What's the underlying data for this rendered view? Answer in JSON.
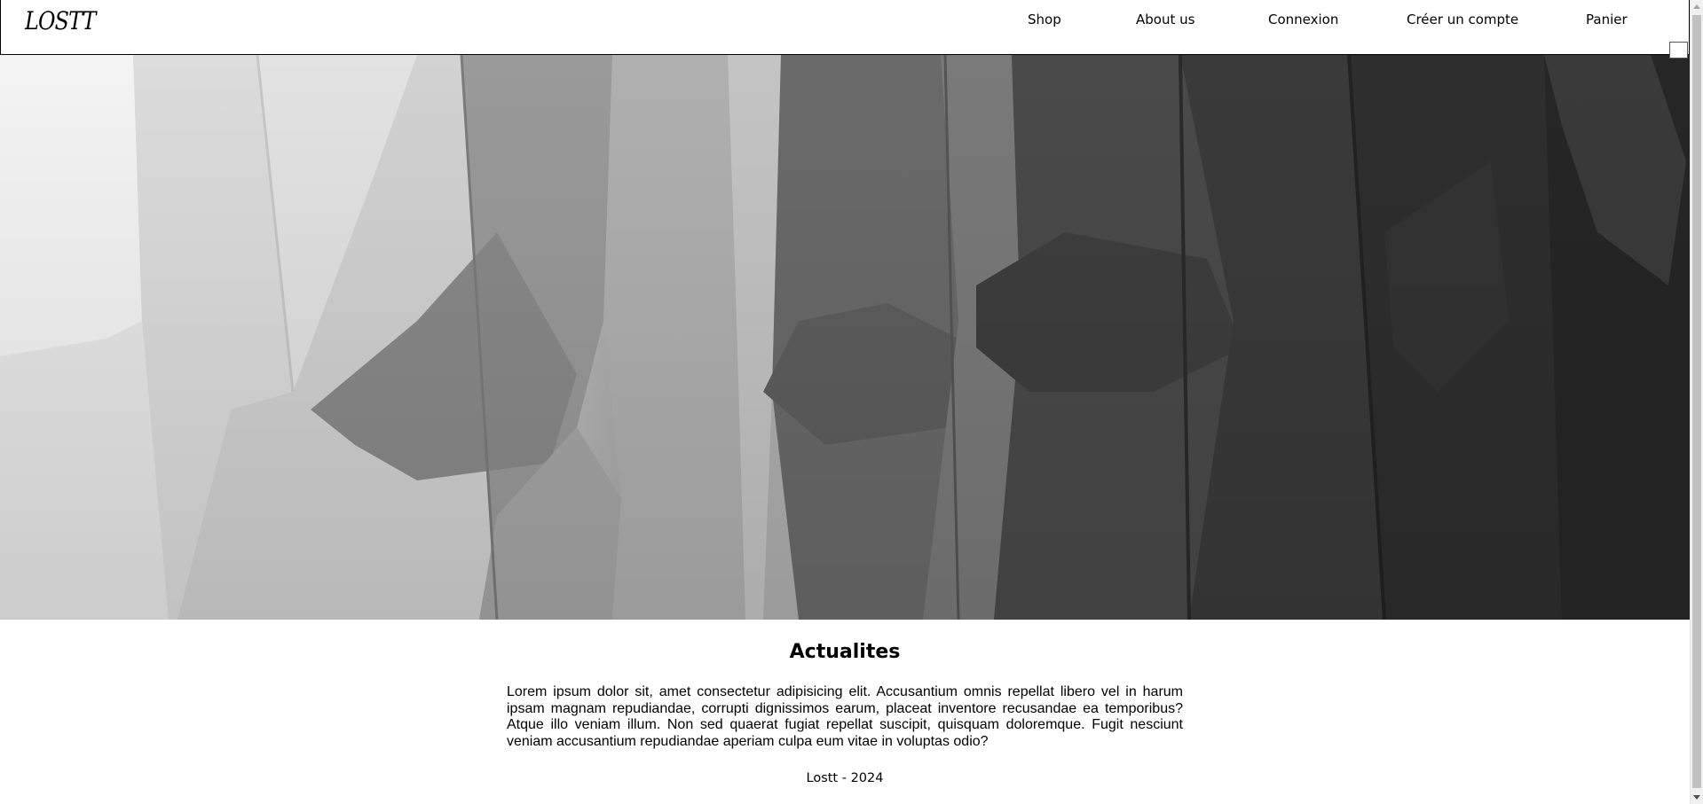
{
  "header": {
    "logo": "LOSTT",
    "nav": {
      "shop": "Shop",
      "about": "About us",
      "login": "Connexion",
      "register": "Créer un compte",
      "cart": "Panier"
    }
  },
  "hero": {
    "image": "grayscale photo of t-shirts hanging on a rack"
  },
  "news": {
    "title": "Actualites",
    "body": "Lorem ipsum dolor sit, amet consectetur adipisicing elit. Accusantium omnis repellat libero vel in harum ipsam magnam repudiandae, corrupti dignissimos earum, placeat inventore recusandae ea temporibus? Atque illo veniam illum. Non sed quaerat fugiat repellat suscipit, quisquam doloremque. Fugit nesciunt veniam accusantium repudiandae aperiam culpa eum vitae in voluptas odio?"
  },
  "footer": {
    "text": "Lostt - 2024"
  },
  "colors": {
    "background": "#ffffff",
    "text": "#000000",
    "border": "#000000"
  }
}
